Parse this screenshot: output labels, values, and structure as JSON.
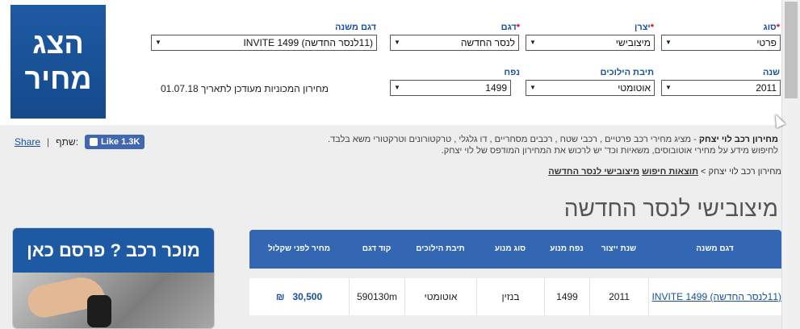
{
  "show_price_button": "הצג מחיר",
  "filters": {
    "type": {
      "label": "סוג",
      "value": "פרטי"
    },
    "manufacturer": {
      "label": "יצרן",
      "value": "מיצובישי"
    },
    "model": {
      "label": "דגם",
      "value": "לנסר החדשה"
    },
    "submodel": {
      "label": "דגם משנה",
      "value": "(11לנסר החדשה) INVITE 1499"
    },
    "year": {
      "label": "שנה",
      "value": "2011"
    },
    "gearbox": {
      "label": "תיבת הילוכים",
      "value": "אוטומטי"
    },
    "engine": {
      "label": "נפח",
      "value": "1499"
    }
  },
  "required_mark": "*",
  "update_note": "מחירון המכוניות מעודכן לתאריך 01.07.18",
  "info": {
    "brand": "מחירון רכב לוי יצחק",
    "line1": " - מציג מחירי רכב פרטיים , רכבי שטח , רכבים מסחריים , דו גלגלי , טרקטורונים וטרקטורי משא בלבד.",
    "line2": "לחיפוש מידע על מחירי אוטובוסים, משאיות וכד' יש לרכוש את המחירון המודפס של לוי יצחק."
  },
  "share": {
    "link": "Share",
    "separator": "|",
    "label": "שתף:",
    "fb_like": "Like 1.3K"
  },
  "breadcrumb": {
    "root": "מחירון רכב לוי יצחק",
    "arrow": ">",
    "results": "תוצאות חיפוש",
    "current": "מיצובישי לנסר החדשה"
  },
  "page_title": "מיצובישי  לנסר החדשה",
  "table": {
    "headers": [
      "דגם משנה",
      "שנת ייצור",
      "נפח מנוע",
      "סוג מנוע",
      "תיבת הילוכים",
      "קוד דגם",
      "מחיר לפני שקלול"
    ],
    "row": {
      "submodel": "(11לנסר החדשה) INVITE 1499",
      "year": "2011",
      "engine_volume": "1499",
      "engine_type": "בנזין",
      "gearbox": "אוטומטי",
      "model_code": "590130m",
      "price": "30,500",
      "currency": "₪"
    }
  },
  "ad": {
    "headline": "מוכר רכב ? פרסם כאן"
  },
  "colors": {
    "brand_blue": "#1e5aa3",
    "table_header": "#3366b3",
    "required": "#d0021b",
    "facebook": "#4267b2"
  }
}
